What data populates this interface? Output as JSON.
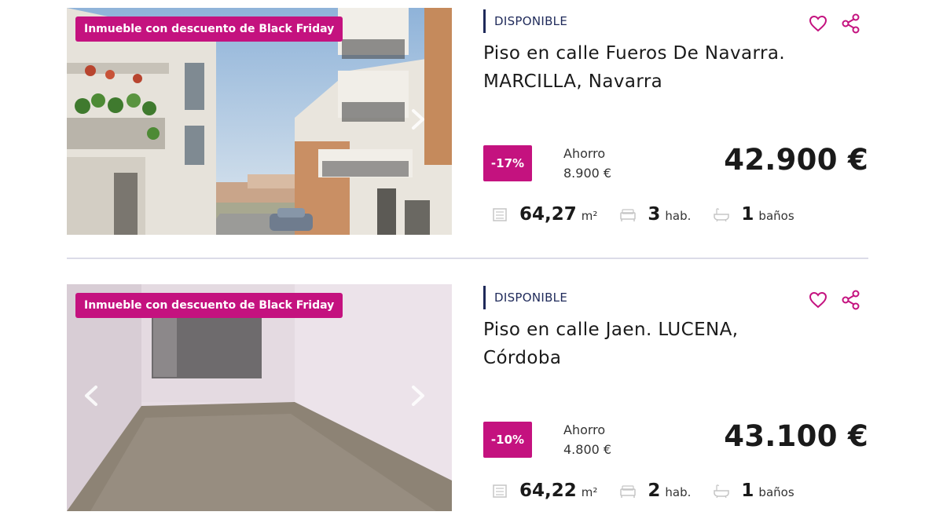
{
  "listings": [
    {
      "promo_tag": "Inmueble con descuento de Black Friday",
      "status": "DISPONIBLE",
      "title": "Piso en calle Fueros De Navarra. MARCILLA, Navarra",
      "discount": "-17%",
      "saving_label": "Ahorro",
      "saving_value": "8.900 €",
      "price": "42.900 €",
      "area_value": "64,27",
      "area_unit": "m²",
      "rooms_value": "3",
      "rooms_unit": "hab.",
      "baths_value": "1",
      "baths_unit": "baños",
      "photo_scene": "street-with-buildings",
      "arrows": [
        "next"
      ]
    },
    {
      "promo_tag": "Inmueble con descuento de Black Friday",
      "status": "DISPONIBLE",
      "title": "Piso en calle Jaen. LUCENA, Córdoba",
      "discount": "-10%",
      "saving_label": "Ahorro",
      "saving_value": "4.800 €",
      "price": "43.100 €",
      "area_value": "64,22",
      "area_unit": "m²",
      "rooms_value": "2",
      "rooms_unit": "hab.",
      "baths_value": "1",
      "baths_unit": "baños",
      "photo_scene": "empty-interior-room",
      "arrows": [
        "prev",
        "next"
      ]
    }
  ],
  "colors": {
    "accent": "#c4127f",
    "status_navy": "#1f2a5a",
    "divider": "#dcdce8"
  },
  "icons": [
    "heart-icon",
    "share-icon",
    "area-icon",
    "bed-icon",
    "bath-icon",
    "chevron-left-icon",
    "chevron-right-icon"
  ]
}
